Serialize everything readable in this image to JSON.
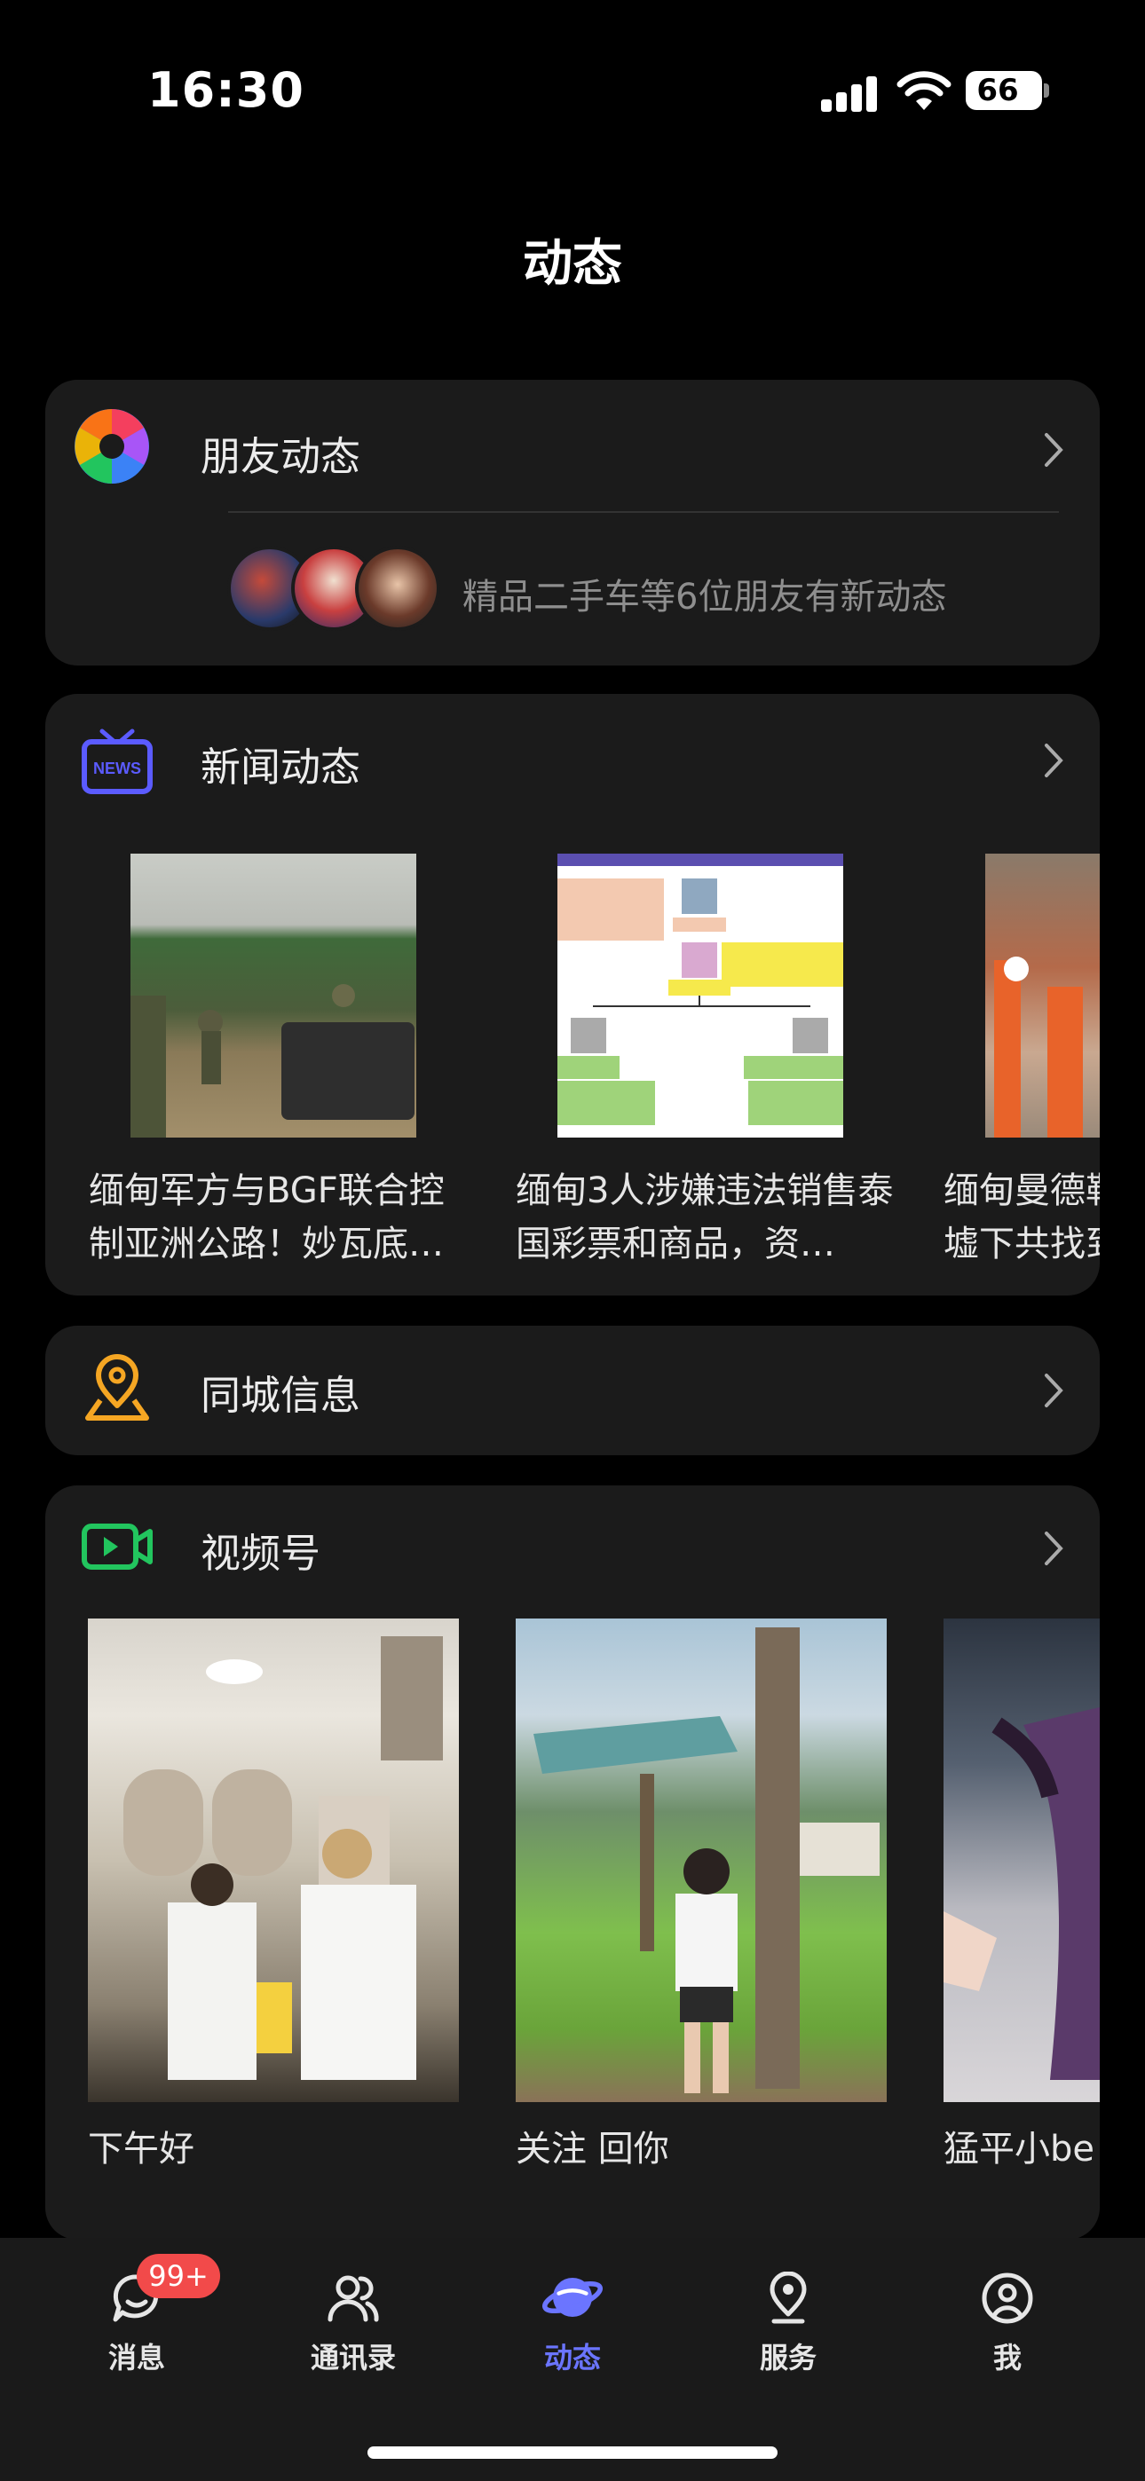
{
  "status_bar": {
    "time": "16:30",
    "battery": "66",
    "icons": [
      "cellular-signal-icon",
      "wifi-icon",
      "battery-icon"
    ]
  },
  "page": {
    "title": "动态"
  },
  "friends": {
    "title": "朋友动态",
    "icon": "aperture-icon",
    "update_text": "精品二手车等6位朋友有新动态"
  },
  "news": {
    "title": "新闻动态",
    "icon": "news-tv-icon",
    "items": [
      {
        "title": "缅甸军方与BGF联合控制亚洲公路！妙瓦底…"
      },
      {
        "title": "缅甸3人涉嫌违法销售泰国彩票和商品，资…"
      },
      {
        "title": "缅甸曼德勒墟下共找到"
      }
    ]
  },
  "local": {
    "title": "同城信息",
    "icon": "location-pin-icon"
  },
  "video": {
    "title": "视频号",
    "icon": "video-channel-icon",
    "items": [
      {
        "title": "下午好"
      },
      {
        "title": "关注 回你"
      },
      {
        "title": "猛平小be"
      }
    ]
  },
  "tab_bar": {
    "badge": "99+",
    "tabs": [
      {
        "label": "消息",
        "icon": "chat-bubble-icon"
      },
      {
        "label": "通讯录",
        "icon": "contacts-icon"
      },
      {
        "label": "动态",
        "icon": "planet-icon"
      },
      {
        "label": "服务",
        "icon": "service-pin-icon"
      },
      {
        "label": "我",
        "icon": "profile-icon"
      }
    ]
  },
  "colors": {
    "accent": "#6b75ff",
    "card_bg": "#1b1b1b",
    "badge": "#f24a4a",
    "video_green": "#22c55e",
    "location_orange": "#f5a623"
  }
}
